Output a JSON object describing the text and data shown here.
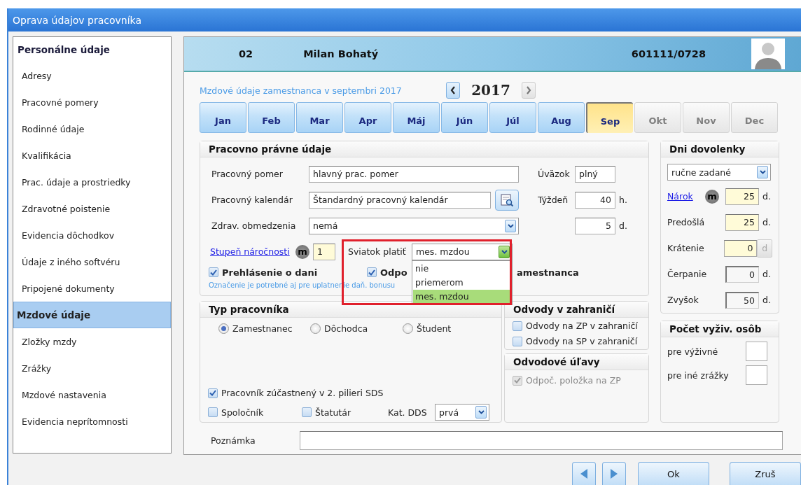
{
  "window": {
    "title": "Oprava údajov pracovníka"
  },
  "sidebar": {
    "header": "Personálne údaje",
    "items": [
      {
        "label": "Adresy",
        "selected": false
      },
      {
        "label": "Pracovné pomery",
        "selected": false
      },
      {
        "label": "Rodinné údaje",
        "selected": false
      },
      {
        "label": "Kvalifikácia",
        "selected": false
      },
      {
        "label": "Prac. údaje a prostriedky",
        "selected": false
      },
      {
        "label": "Zdravotné poistenie",
        "selected": false
      },
      {
        "label": "Evidencia dôchodkov",
        "selected": false
      },
      {
        "label": "Údaje z iného softvéru",
        "selected": false
      },
      {
        "label": "Pripojené dokumenty",
        "selected": false
      },
      {
        "label": "Mzdové údaje",
        "selected": true
      },
      {
        "label": "Zložky mzdy",
        "selected": false
      },
      {
        "label": "Zrážky",
        "selected": false
      },
      {
        "label": "Mzdové nastavenia",
        "selected": false
      },
      {
        "label": "Evidencia neprítomnosti",
        "selected": false
      }
    ]
  },
  "header": {
    "number": "02",
    "name": "Milan Bohatý",
    "birth_number": "601111/0728"
  },
  "period": {
    "caption": "Mzdové údaje zamestnanca v septembri 2017",
    "year": "2017"
  },
  "months": [
    {
      "label": "Jan",
      "selected": false,
      "disabled": false
    },
    {
      "label": "Feb",
      "selected": false,
      "disabled": false
    },
    {
      "label": "Mar",
      "selected": false,
      "disabled": false
    },
    {
      "label": "Apr",
      "selected": false,
      "disabled": false
    },
    {
      "label": "Máj",
      "selected": false,
      "disabled": false
    },
    {
      "label": "Jún",
      "selected": false,
      "disabled": false
    },
    {
      "label": "Júl",
      "selected": false,
      "disabled": false
    },
    {
      "label": "Aug",
      "selected": false,
      "disabled": false
    },
    {
      "label": "Sep",
      "selected": true,
      "disabled": false
    },
    {
      "label": "Okt",
      "selected": false,
      "disabled": true
    },
    {
      "label": "Nov",
      "selected": false,
      "disabled": true
    },
    {
      "label": "Dec",
      "selected": false,
      "disabled": true
    }
  ],
  "employment": {
    "title": "Pracovno právne údaje",
    "employment_type": {
      "label": "Pracovný pomer",
      "value": "hlavný prac. pomer"
    },
    "calendar": {
      "label": "Pracovný kalendár",
      "value": "Štandardný pracovný kalendár"
    },
    "health": {
      "label": "Zdrav. obmedzenia",
      "value": "nemá"
    },
    "workload": {
      "label": "Úväzok",
      "value": "plný"
    },
    "week": {
      "label": "Týždeň",
      "value": "40",
      "unit": "h."
    },
    "days": {
      "value": "5",
      "unit": "d."
    },
    "difficulty": {
      "label": "Stupeň náročnosti",
      "badge": "m",
      "value": "1"
    },
    "holiday_pay": {
      "label": "Sviatok platiť",
      "value": "mes. mzdou",
      "expanded": true,
      "options": [
        {
          "label": "nie",
          "selected": false
        },
        {
          "label": "priemerom",
          "selected": false
        },
        {
          "label": "mes. mzdou",
          "selected": true
        }
      ]
    },
    "tax_declaration": {
      "label": "Prehlásenie o dani",
      "checked": true
    },
    "deduction": {
      "label": "Odpo",
      "checked": true
    },
    "deduction_tail": "amestnanca",
    "hint": "Označenie je potrebné aj pre uplatnenie daň. bonusu"
  },
  "worker_type": {
    "title": "Typ pracovníka",
    "types": [
      {
        "label": "Zamestnanec",
        "selected": true
      },
      {
        "label": "Dôchodca",
        "selected": false
      },
      {
        "label": "Študent",
        "selected": false
      }
    ],
    "pillar": {
      "label": "Pracovník zúčastnený v 2. pilieri SDS",
      "checked": true
    },
    "partner": {
      "label": "Spoločník",
      "checked": false
    },
    "statutory": {
      "label": "Štatutár",
      "checked": false
    },
    "dds": {
      "label": "Kat. DDS",
      "value": "prvá"
    }
  },
  "foreign": {
    "title": "Odvody v zahraničí",
    "items": [
      {
        "label": "Odvody na ZP v zahraničí",
        "checked": false,
        "disabled": false
      },
      {
        "label": "Odvody na SP v zahraničí",
        "checked": false,
        "disabled": false
      }
    ]
  },
  "relief": {
    "title": "Odvodové úľavy",
    "items": [
      {
        "label": "Odpoč. položka na ZP",
        "checked": true,
        "disabled": true
      }
    ]
  },
  "vacation": {
    "title": "Dni dovolenky",
    "mode": "ručne zadané",
    "rows": [
      {
        "label": "Nárok",
        "kind": "link",
        "badge": "m",
        "value": "25",
        "unit": "d.",
        "editable": true,
        "unit_disabled": false
      },
      {
        "label": "Predošlá",
        "kind": "text",
        "value": "25",
        "unit": "d.",
        "editable": true,
        "unit_disabled": false
      },
      {
        "label": "Krátenie",
        "kind": "text",
        "value": "0",
        "unit": "d",
        "editable": true,
        "unit_disabled": true
      },
      {
        "label": "Čerpanie",
        "kind": "text",
        "value": "0",
        "unit": "d.",
        "editable": false,
        "unit_disabled": false
      },
      {
        "label": "Zvyšok",
        "kind": "text",
        "value": "50",
        "unit": "d.",
        "editable": false,
        "unit_disabled": false
      }
    ]
  },
  "dependents": {
    "title": "Počet vyživ. osôb",
    "rows": [
      {
        "label": "pre výživné"
      },
      {
        "label": "pre iné zrážky"
      }
    ]
  },
  "note": {
    "label": "Poznámka"
  },
  "buttons": {
    "ok": "Ok",
    "cancel": "Zruš"
  }
}
